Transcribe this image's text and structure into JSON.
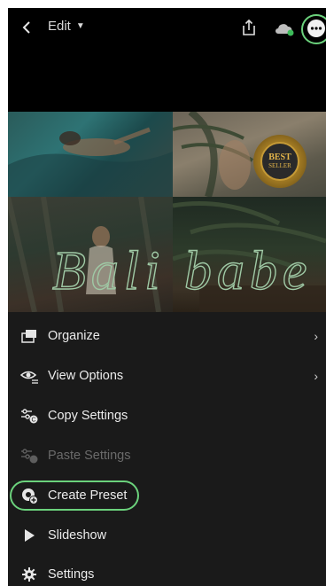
{
  "topbar": {
    "edit_label": "Edit",
    "icons": [
      "back-icon",
      "share-icon",
      "cloud-sync-icon",
      "more-icon"
    ]
  },
  "photo": {
    "watermark_text": "Bali babe",
    "badge_line1": "BEST",
    "badge_line2": "SELLER"
  },
  "menu": {
    "items": [
      {
        "label": "Organize",
        "icon": "organize-icon",
        "chevron": true
      },
      {
        "label": "View Options",
        "icon": "view-options-icon",
        "chevron": true
      },
      {
        "label": "Copy Settings",
        "icon": "copy-settings-icon"
      },
      {
        "label": "Paste Settings",
        "icon": "paste-settings-icon",
        "disabled": true
      },
      {
        "label": "Create Preset",
        "icon": "create-preset-icon"
      },
      {
        "label": "Slideshow",
        "icon": "play-icon"
      },
      {
        "label": "Settings",
        "icon": "gear-icon"
      }
    ]
  },
  "colors": {
    "highlight": "#6bd27c",
    "menu_background": "#1a1a1a",
    "topbar_background": "#000000"
  }
}
